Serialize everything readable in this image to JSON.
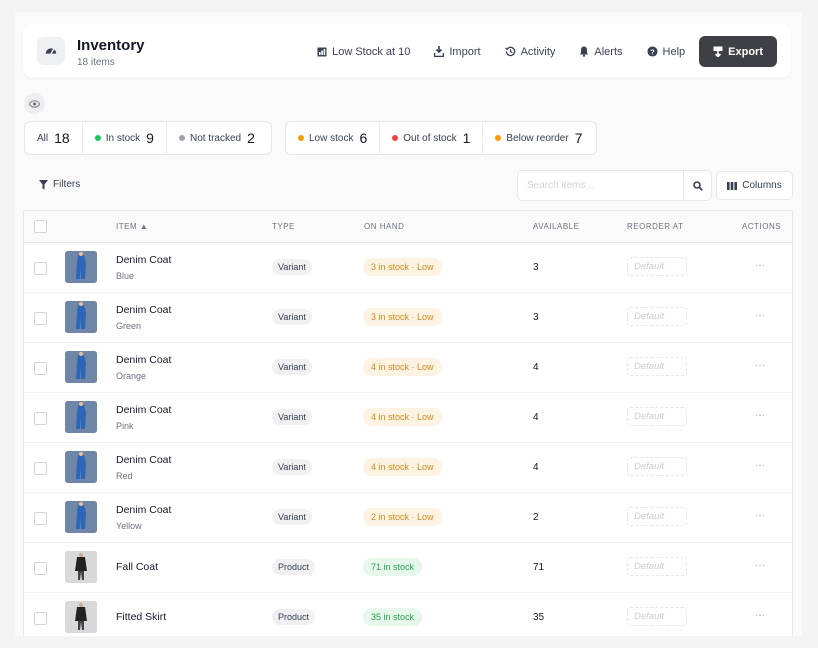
{
  "header": {
    "title": "Inventory",
    "subtitle": "18 items",
    "actions": [
      {
        "label": "Low Stock at 10",
        "icon": "low-stock-icon"
      },
      {
        "label": "Import",
        "icon": "import-icon"
      },
      {
        "label": "Activity",
        "icon": "history-icon"
      },
      {
        "label": "Alerts",
        "icon": "bell-icon"
      },
      {
        "label": "Help",
        "icon": "help-icon"
      }
    ],
    "export_label": "Export"
  },
  "status_filters": [
    {
      "label": "All",
      "count": "18"
    },
    {
      "label": "In stock",
      "count": "9",
      "color": "#22c55e"
    },
    {
      "label": "Not tracked",
      "count": "2",
      "color": "#9ca3af"
    }
  ],
  "alert_filters": [
    {
      "label": "Low stock",
      "count": "6",
      "color": "#f59e0b"
    },
    {
      "label": "Out of stock",
      "count": "1",
      "color": "#ef4444"
    },
    {
      "label": "Below reorder",
      "count": "7",
      "color": "#f59e0b"
    }
  ],
  "toolbar": {
    "filters_label": "Filters",
    "search_placeholder": "Search items...",
    "columns_label": "Columns"
  },
  "table": {
    "headers": {
      "item": "ITEM ▲",
      "type": "TYPE",
      "on_hand": "ON HAND",
      "available": "AVAILABLE",
      "reorder_at": "REORDER AT",
      "actions": "ACTIONS"
    },
    "reorder_placeholder": "Default",
    "action_glyph": "···",
    "rows": [
      {
        "name": "Denim Coat",
        "variant": "Blue",
        "type": "Variant",
        "on_hand": "3 in stock · Low",
        "status": "low",
        "available": "3"
      },
      {
        "name": "Denim Coat",
        "variant": "Green",
        "type": "Variant",
        "on_hand": "3 in stock · Low",
        "status": "low",
        "available": "3"
      },
      {
        "name": "Denim Coat",
        "variant": "Orange",
        "type": "Variant",
        "on_hand": "4 in stock · Low",
        "status": "low",
        "available": "4"
      },
      {
        "name": "Denim Coat",
        "variant": "Pink",
        "type": "Variant",
        "on_hand": "4 in stock · Low",
        "status": "low",
        "available": "4"
      },
      {
        "name": "Denim Coat",
        "variant": "Red",
        "type": "Variant",
        "on_hand": "4 in stock · Low",
        "status": "low",
        "available": "4"
      },
      {
        "name": "Denim Coat",
        "variant": "Yellow",
        "type": "Variant",
        "on_hand": "2 in stock · Low",
        "status": "low",
        "available": "2"
      },
      {
        "name": "Fall Coat",
        "variant": "",
        "type": "Product",
        "on_hand": "71 in stock",
        "status": "ok",
        "available": "71"
      },
      {
        "name": "Fitted Skirt",
        "variant": "",
        "type": "Product",
        "on_hand": "35 in stock",
        "status": "ok",
        "available": "35"
      }
    ]
  },
  "colors": {
    "accent_dark": "#3f3f46",
    "low_text": "#d08a1c",
    "low_bg": "#fdf3e3",
    "ok_text": "#22a352",
    "ok_bg": "#e7f7ec"
  }
}
